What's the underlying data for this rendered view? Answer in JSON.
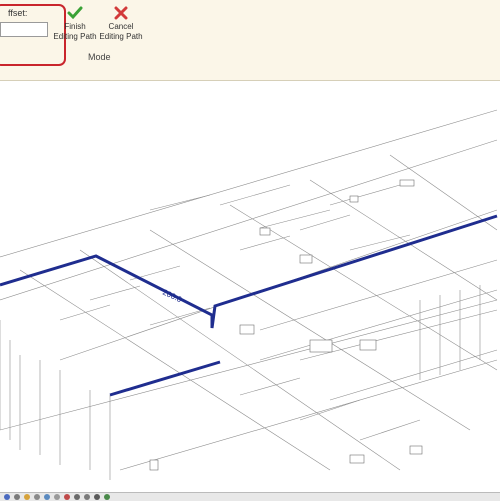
{
  "ribbon": {
    "offset_label": "ffset:",
    "offset_value": "",
    "finish_label_1": "Finish",
    "finish_label_2": "Editing Path",
    "cancel_label_1": "Cancel",
    "cancel_label_2": "Editing Path",
    "group_label": "Mode"
  },
  "viewport": {
    "dimension_label": "200.0",
    "path_color": "#1f2d8f",
    "highlight_color": "#c9252c"
  },
  "icons": {
    "finish": "check-icon",
    "cancel": "x-icon"
  }
}
